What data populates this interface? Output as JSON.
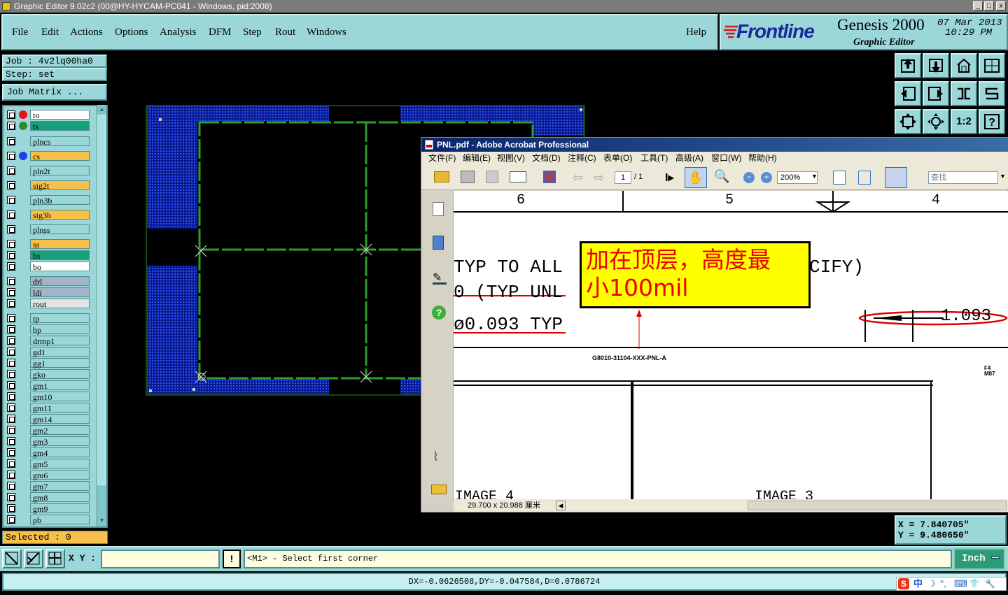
{
  "window": {
    "title": "Graphic Editor 9.02c2 (00@HY-HYCAM-PC041 - Windows, pid:2008)",
    "controls": [
      "_",
      "□",
      "x"
    ]
  },
  "menu": {
    "items": [
      "File",
      "Edit",
      "Actions",
      "Options",
      "Analysis",
      "DFM",
      "Step",
      "Rout",
      "Windows"
    ],
    "help": "Help"
  },
  "brand": {
    "logo": "Frontline",
    "product": "Genesis 2000",
    "subtitle": "Graphic Editor",
    "date": "07 Mar 2013",
    "time": "10:29 PM"
  },
  "job": {
    "job_label": "Job : 4v2lq00ha0",
    "step_label": "Step: set",
    "matrix_button": "Job Matrix ..."
  },
  "layers": [
    {
      "name": "to",
      "bg": "#ffffff",
      "dot": "#e81010"
    },
    {
      "name": "ts",
      "bg": "#17a07a",
      "dot": "#2e8b2e"
    },
    {
      "name": "plncs",
      "bg": "#9bd7d9",
      "dot": ""
    },
    {
      "name": "cs",
      "bg": "#f7c04a",
      "dot": "#1f3fe8"
    },
    {
      "name": "pln2t",
      "bg": "#9bd7d9",
      "dot": ""
    },
    {
      "name": "sig2t",
      "bg": "#f7c04a",
      "dot": ""
    },
    {
      "name": "pln3b",
      "bg": "#9bd7d9",
      "dot": ""
    },
    {
      "name": "sig3b",
      "bg": "#f7c04a",
      "dot": ""
    },
    {
      "name": "plnss",
      "bg": "#9bd7d9",
      "dot": ""
    },
    {
      "name": "ss",
      "bg": "#f7c04a",
      "dot": ""
    },
    {
      "name": "bs",
      "bg": "#17a07a",
      "dot": ""
    },
    {
      "name": "bo",
      "bg": "#ffffff",
      "dot": ""
    },
    {
      "name": "drl",
      "bg": "#a0b6c6",
      "dot": ""
    },
    {
      "name": "ldi",
      "bg": "#a0b6c6",
      "dot": ""
    },
    {
      "name": "rout",
      "bg": "#e3e3e3",
      "dot": ""
    },
    {
      "name": "tp",
      "bg": "#9bd7d9",
      "dot": ""
    },
    {
      "name": "bp",
      "bg": "#9bd7d9",
      "dot": ""
    },
    {
      "name": "drmp1",
      "bg": "#9bd7d9",
      "dot": ""
    },
    {
      "name": "gd1",
      "bg": "#9bd7d9",
      "dot": ""
    },
    {
      "name": "gg1",
      "bg": "#9bd7d9",
      "dot": ""
    },
    {
      "name": "gko",
      "bg": "#9bd7d9",
      "dot": ""
    },
    {
      "name": "gm1",
      "bg": "#9bd7d9",
      "dot": ""
    },
    {
      "name": "gm10",
      "bg": "#9bd7d9",
      "dot": ""
    },
    {
      "name": "gm11",
      "bg": "#9bd7d9",
      "dot": ""
    },
    {
      "name": "gm14",
      "bg": "#9bd7d9",
      "dot": ""
    },
    {
      "name": "gm2",
      "bg": "#9bd7d9",
      "dot": ""
    },
    {
      "name": "gm3",
      "bg": "#9bd7d9",
      "dot": ""
    },
    {
      "name": "gm4",
      "bg": "#9bd7d9",
      "dot": ""
    },
    {
      "name": "gm5",
      "bg": "#9bd7d9",
      "dot": ""
    },
    {
      "name": "gm6",
      "bg": "#9bd7d9",
      "dot": ""
    },
    {
      "name": "gm7",
      "bg": "#9bd7d9",
      "dot": ""
    },
    {
      "name": "gm8",
      "bg": "#9bd7d9",
      "dot": ""
    },
    {
      "name": "gm9",
      "bg": "#9bd7d9",
      "dot": ""
    },
    {
      "name": "pb",
      "bg": "#9bd7d9",
      "dot": ""
    }
  ],
  "selected": "Selected : 0",
  "tools": [
    "panel-up-icon",
    "panel-down-icon",
    "home-icon",
    "split-icon",
    "move-left-icon",
    "move-right-icon",
    "snake-icon",
    "rotate-icon",
    "zoom-fit-icon",
    "zoom-center-icon",
    "one-to-two-icon",
    "help-icon"
  ],
  "tool_labels": {
    "ratio": "1:2",
    "help": "?"
  },
  "coords": {
    "x": "X  = 7.840705\"",
    "y": "Y  = 9.480650\""
  },
  "bottom": {
    "xy_label": "X Y :",
    "xy_value": "",
    "alert": "!",
    "prompt": "<M1> - Select first corner",
    "units": "Inch"
  },
  "status": "DX=-0.0626508,DY=-0.047584,D=0.0786724",
  "tray": [
    "S",
    "中",
    "☽",
    "°,",
    "⌨",
    "👕",
    "🔧"
  ],
  "acrobat": {
    "title": "PNL.pdf - Adobe Acrobat Professional",
    "menu": [
      "文件(F)",
      "编辑(E)",
      "视图(V)",
      "文档(D)",
      "注释(C)",
      "表单(O)",
      "工具(T)",
      "高级(A)",
      "窗口(W)",
      "帮助(H)"
    ],
    "page_current": "1",
    "page_total": "/ 1",
    "zoom": "200%",
    "search_placeholder": "查找",
    "page_size": "29.700 x 20.988 厘米",
    "doc": {
      "col6": "6",
      "col5": "5",
      "col4": "4",
      "line1a": "TYP TO ALL",
      "line1b": "CIFY)",
      "line2": "0 (TYP UNL",
      "line3": "ø0.093 TYP",
      "dim": "1.093",
      "note_line1": "加在顶层，高度最",
      "note_line2": "小100mil",
      "part": "G8010-31104-XXX-PNL-A",
      "mark": "F4\nM87",
      "image4": "IMAGE 4",
      "image3": "IMAGE 3"
    }
  }
}
